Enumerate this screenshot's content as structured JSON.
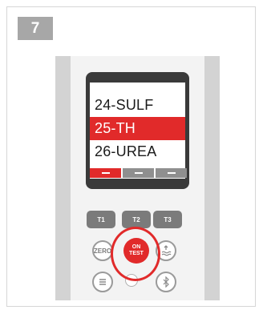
{
  "step": {
    "number": "7"
  },
  "screen": {
    "menu_items": [
      "24-SULF",
      "25-TH",
      "26-UREA"
    ],
    "selected_index": 1
  },
  "keys": {
    "t1": "T1",
    "t2": "T2",
    "t3": "T3",
    "zero": "ZERO",
    "on_line1": "ON",
    "on_line2": "TEST"
  },
  "colors": {
    "accent": "#e12a2a",
    "badge": "#a7a7a7",
    "device_body": "#d3d3d3"
  }
}
